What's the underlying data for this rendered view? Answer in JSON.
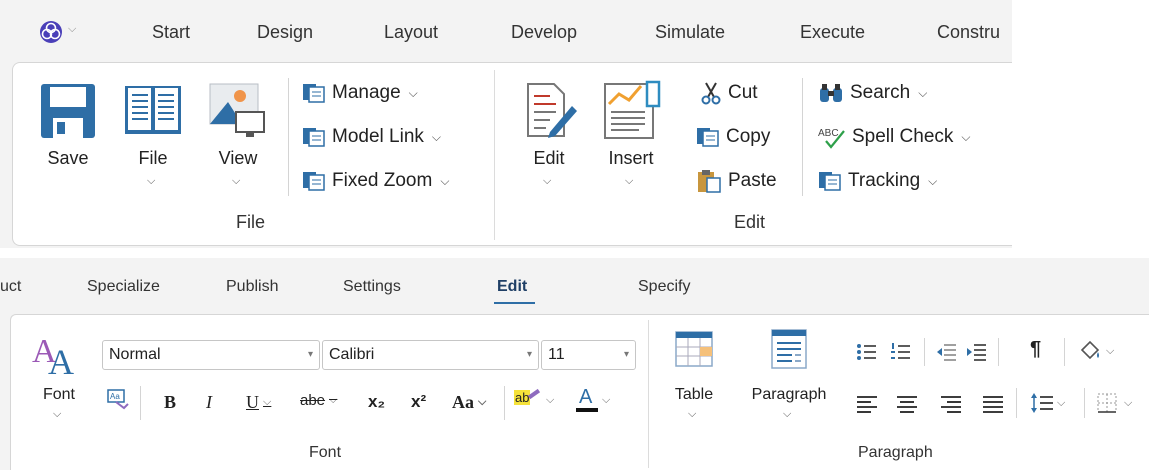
{
  "top": {
    "tabs": [
      "Start",
      "Design",
      "Layout",
      "Develop",
      "Simulate",
      "Execute",
      "Constru"
    ],
    "file_group": {
      "label": "File",
      "save": "Save",
      "file": "File",
      "view": "View",
      "manage": "Manage",
      "model_link": "Model Link",
      "fixed_zoom": "Fixed Zoom"
    },
    "edit_group": {
      "label": "Edit",
      "edit": "Edit",
      "insert": "Insert",
      "cut": "Cut",
      "copy": "Copy",
      "paste": "Paste",
      "search": "Search",
      "spell_check": "Spell Check",
      "tracking": "Tracking"
    }
  },
  "bottom": {
    "tabs": [
      "uct",
      "Specialize",
      "Publish",
      "Settings",
      "Edit",
      "Specify"
    ],
    "active_tab": "Edit",
    "font_group": {
      "label": "Font",
      "font_button": "Font",
      "style_value": "Normal",
      "font_value": "Calibri",
      "size_value": "11",
      "bold": "B",
      "italic": "I",
      "underline": "U",
      "strike": "abe",
      "subscript": "x₂",
      "superscript": "x²",
      "change_case": "Aa",
      "highlight": "ab",
      "font_color": "A"
    },
    "paragraph_group": {
      "label": "Paragraph",
      "table": "Table",
      "paragraph": "Paragraph",
      "pilcrow": "¶"
    }
  },
  "colors": {
    "accent_blue": "#2e6ea6",
    "active_underline": "#2e6ea6",
    "font_color_bar": "#c00000",
    "highlight_yellow": "#f5e23a"
  }
}
